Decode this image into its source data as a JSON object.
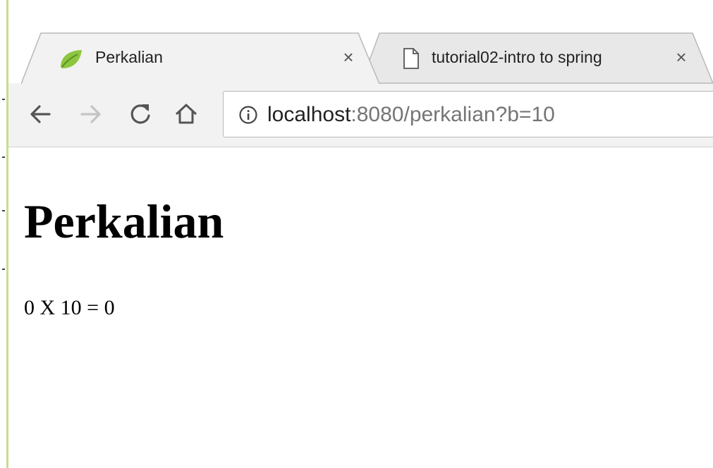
{
  "browser": {
    "tabs": [
      {
        "title": "Perkalian",
        "favicon": "spring-leaf-icon",
        "active": true
      },
      {
        "title": "tutorial02-intro to spring",
        "favicon": "document-icon",
        "active": false
      }
    ],
    "close_glyph": "×",
    "address": {
      "host": "localhost",
      "path": ":8080/perkalian?b=10"
    },
    "icons": {
      "back": "back-arrow-icon",
      "forward": "forward-arrow-icon",
      "reload": "reload-icon",
      "home": "home-icon",
      "info": "info-icon"
    },
    "colors": {
      "toolbar": "#f2f2f2",
      "favicon_leaf": "#8dc63f",
      "forward_disabled": "#c4c4c4"
    }
  },
  "page": {
    "heading": "Perkalian",
    "result": "0 X 10 = 0"
  }
}
